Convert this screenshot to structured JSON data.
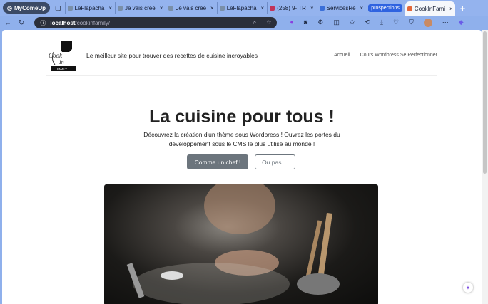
{
  "browser": {
    "profile": "MyComeUp",
    "tabs": [
      {
        "title": "LeFlapacha"
      },
      {
        "title": "Je vais crée"
      },
      {
        "title": "Je vais crée"
      },
      {
        "title": "LeFlapacha"
      },
      {
        "title": "(258) 9- TR"
      },
      {
        "title": "ServicesRé"
      }
    ],
    "group_label": "prospections",
    "active_tab": "CookInFami",
    "url_host": "localhost",
    "url_path": "/cookinfamily/"
  },
  "site": {
    "logo_text": "Cook In FAMILY",
    "tagline": "Le meilleur site pour trouver des recettes de cuisine incroyables !",
    "nav": [
      "Accueil",
      "Cours Wordpress Se Perfectionner"
    ],
    "title": "La cuisine pour tous !",
    "lead": "Découvrez la création d'un thème sous Wordpress ! Ouvrez les portes du développement sous le CMS le plus utilisé au monde !",
    "primary_button": "Comme un chef !",
    "secondary_button": "Ou pas ..."
  }
}
